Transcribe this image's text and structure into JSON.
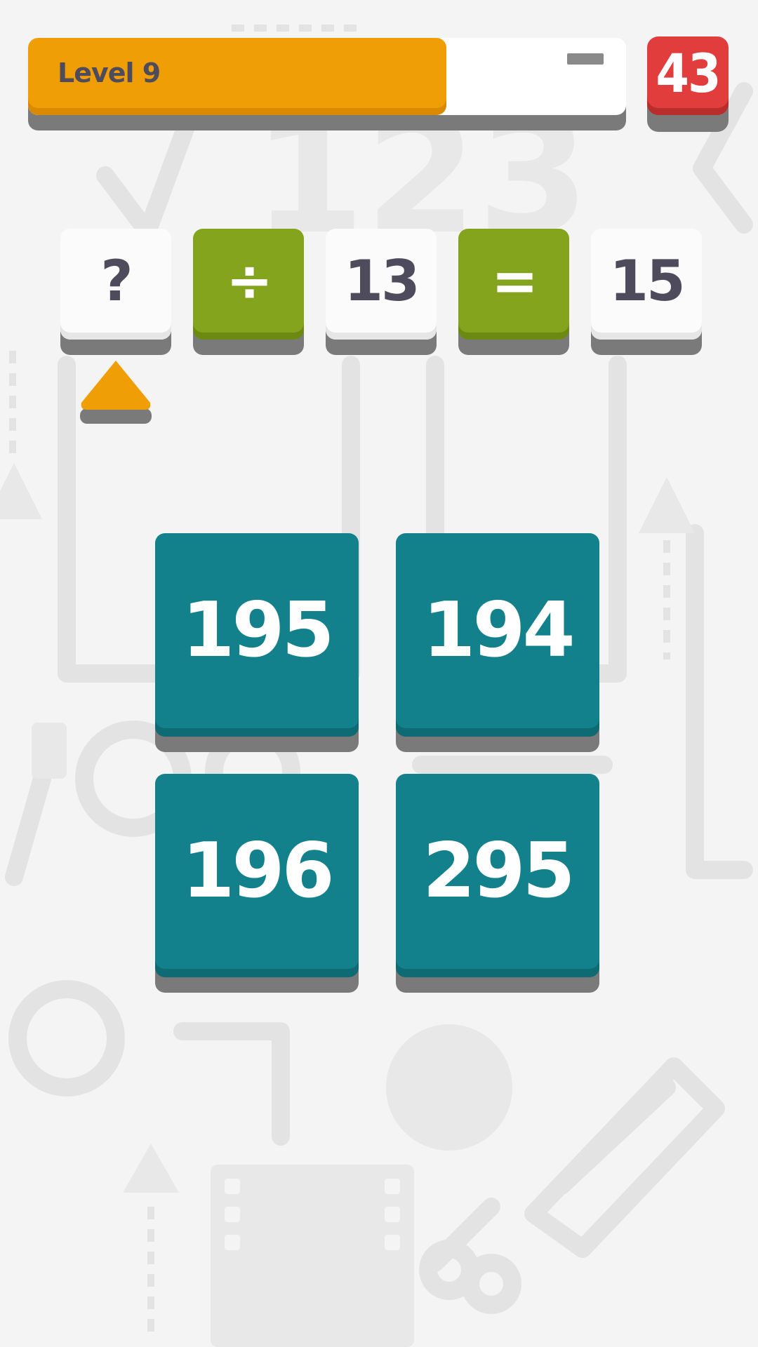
{
  "progress": {
    "label": "Level 9",
    "fill_fraction": 0.7
  },
  "timer": {
    "value": "43"
  },
  "equation": [
    {
      "text": "?",
      "style": "white",
      "name": "unknown-tile"
    },
    {
      "text": "÷",
      "style": "green",
      "name": "divide-operator-tile"
    },
    {
      "text": "13",
      "style": "white",
      "name": "operand-tile"
    },
    {
      "text": "=",
      "style": "green",
      "name": "equals-operator-tile"
    },
    {
      "text": "15",
      "style": "white",
      "name": "result-tile"
    }
  ],
  "answers": [
    "195",
    "194",
    "196",
    "295"
  ],
  "colors": {
    "progress": "#f09e06",
    "timer": "#e23d3d",
    "operator": "#85a41d",
    "answer": "#13818c",
    "text_dark": "#4e4b5c"
  }
}
